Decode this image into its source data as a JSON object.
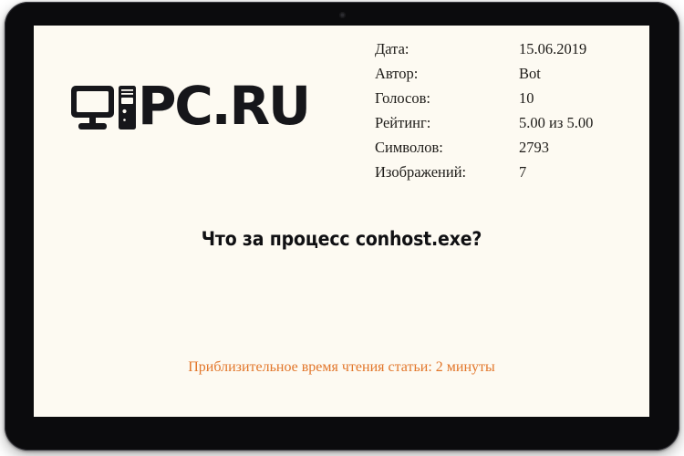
{
  "device": {
    "type": "tablet-monitor-frame",
    "bezel_color": "#0b0b0d",
    "screen_color": "#fdfaf2",
    "camera_icon": "camera-dot-icon"
  },
  "logo": {
    "text": "PC.RU",
    "monitor_icon": "desktop-monitor-icon",
    "tower_icon": "pc-tower-icon",
    "color": "#16161a"
  },
  "meta": {
    "rows": [
      {
        "label": "Дата:",
        "value": "15.06.2019"
      },
      {
        "label": "Автор:",
        "value": "Bot"
      },
      {
        "label": "Голосов:",
        "value": "10"
      },
      {
        "label": "Рейтинг:",
        "value": "5.00 из 5.00"
      },
      {
        "label": "Символов:",
        "value": "2793"
      },
      {
        "label": "Изображений:",
        "value": "7"
      }
    ]
  },
  "headline": {
    "text": "Что за процесс conhost.exe?"
  },
  "footer": {
    "reading_time": "Приблизительное время чтения статьи: 2 минуты",
    "color": "#e2762a"
  }
}
